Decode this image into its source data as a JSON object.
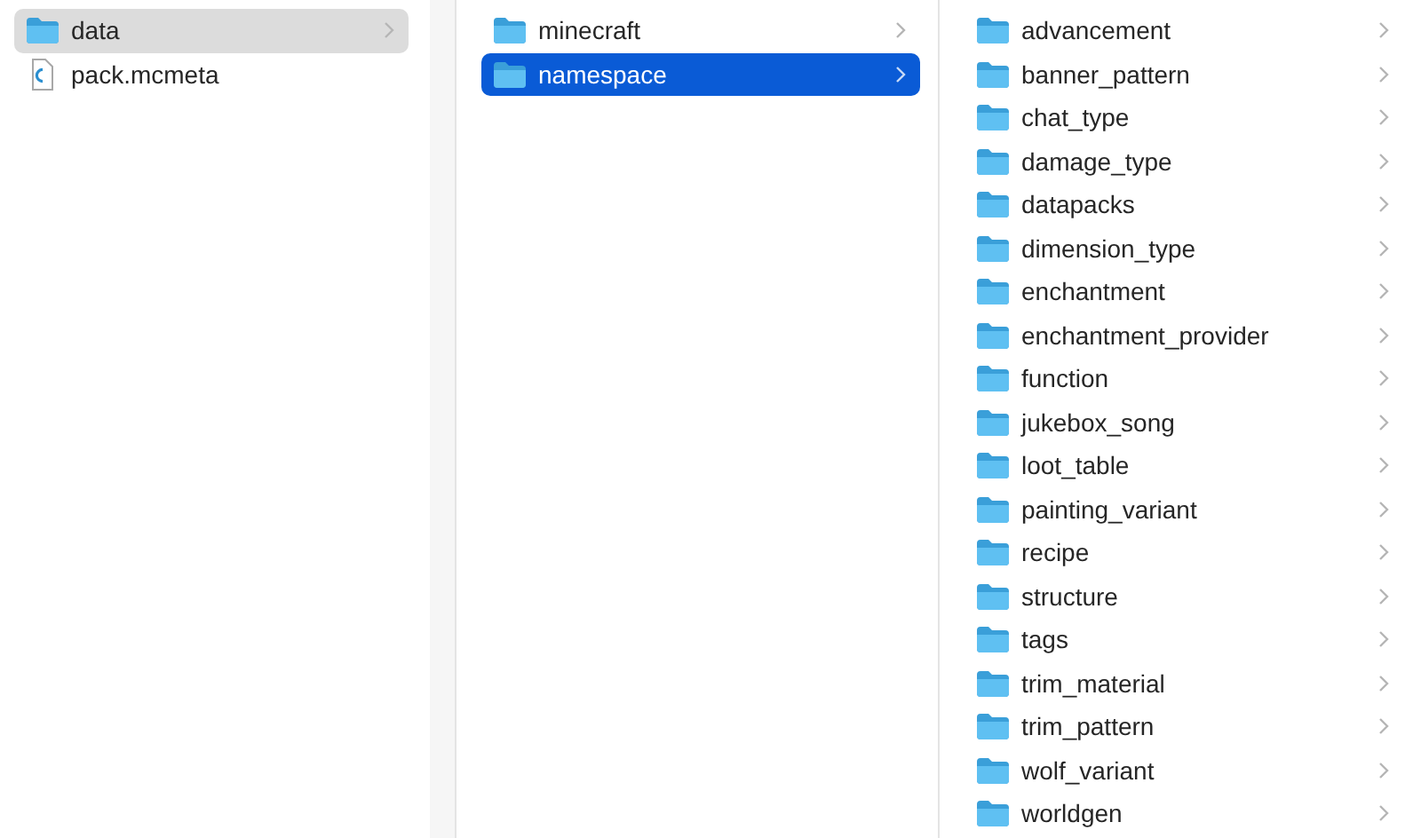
{
  "columns": [
    {
      "active": false,
      "items": [
        {
          "kind": "folder",
          "name": "data",
          "selected": true
        },
        {
          "kind": "file",
          "name": "pack.mcmeta",
          "selected": false
        }
      ]
    },
    {
      "active": true,
      "items": [
        {
          "kind": "folder",
          "name": "minecraft",
          "selected": false
        },
        {
          "kind": "folder",
          "name": "namespace",
          "selected": true
        }
      ]
    },
    {
      "items": [
        {
          "kind": "folder",
          "name": "advancement",
          "selected": false
        },
        {
          "kind": "folder",
          "name": "banner_pattern",
          "selected": false
        },
        {
          "kind": "folder",
          "name": "chat_type",
          "selected": false
        },
        {
          "kind": "folder",
          "name": "damage_type",
          "selected": false
        },
        {
          "kind": "folder",
          "name": "datapacks",
          "selected": false
        },
        {
          "kind": "folder",
          "name": "dimension_type",
          "selected": false
        },
        {
          "kind": "folder",
          "name": "enchantment",
          "selected": false
        },
        {
          "kind": "folder",
          "name": "enchantment_provider",
          "selected": false
        },
        {
          "kind": "folder",
          "name": "function",
          "selected": false
        },
        {
          "kind": "folder",
          "name": "jukebox_song",
          "selected": false
        },
        {
          "kind": "folder",
          "name": "loot_table",
          "selected": false
        },
        {
          "kind": "folder",
          "name": "painting_variant",
          "selected": false
        },
        {
          "kind": "folder",
          "name": "recipe",
          "selected": false
        },
        {
          "kind": "folder",
          "name": "structure",
          "selected": false
        },
        {
          "kind": "folder",
          "name": "tags",
          "selected": false
        },
        {
          "kind": "folder",
          "name": "trim_material",
          "selected": false
        },
        {
          "kind": "folder",
          "name": "trim_pattern",
          "selected": false
        },
        {
          "kind": "folder",
          "name": "wolf_variant",
          "selected": false
        },
        {
          "kind": "folder",
          "name": "worldgen",
          "selected": false
        }
      ]
    }
  ]
}
